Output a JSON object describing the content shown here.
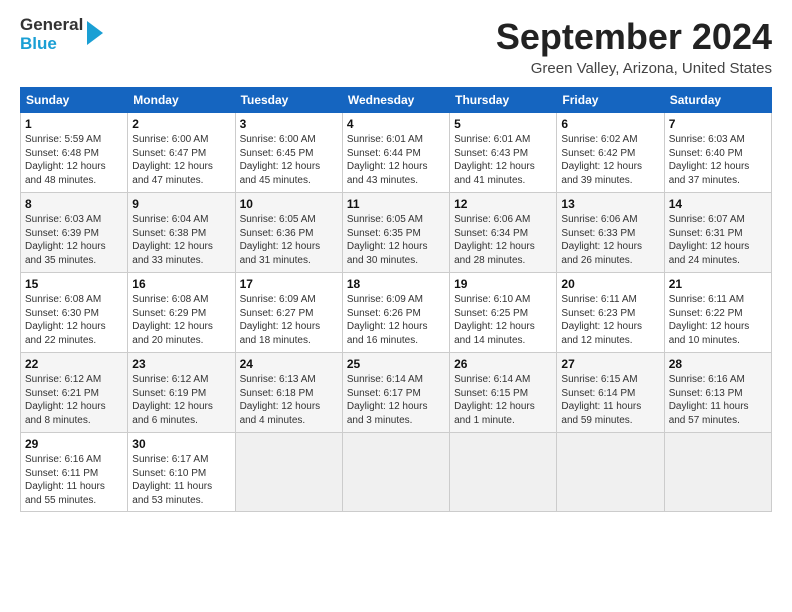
{
  "header": {
    "logo_line1": "General",
    "logo_line2": "Blue",
    "month": "September 2024",
    "location": "Green Valley, Arizona, United States"
  },
  "days_of_week": [
    "Sunday",
    "Monday",
    "Tuesday",
    "Wednesday",
    "Thursday",
    "Friday",
    "Saturday"
  ],
  "weeks": [
    {
      "days": [
        {
          "num": "1",
          "info": "Sunrise: 5:59 AM\nSunset: 6:48 PM\nDaylight: 12 hours\nand 48 minutes."
        },
        {
          "num": "2",
          "info": "Sunrise: 6:00 AM\nSunset: 6:47 PM\nDaylight: 12 hours\nand 47 minutes."
        },
        {
          "num": "3",
          "info": "Sunrise: 6:00 AM\nSunset: 6:45 PM\nDaylight: 12 hours\nand 45 minutes."
        },
        {
          "num": "4",
          "info": "Sunrise: 6:01 AM\nSunset: 6:44 PM\nDaylight: 12 hours\nand 43 minutes."
        },
        {
          "num": "5",
          "info": "Sunrise: 6:01 AM\nSunset: 6:43 PM\nDaylight: 12 hours\nand 41 minutes."
        },
        {
          "num": "6",
          "info": "Sunrise: 6:02 AM\nSunset: 6:42 PM\nDaylight: 12 hours\nand 39 minutes."
        },
        {
          "num": "7",
          "info": "Sunrise: 6:03 AM\nSunset: 6:40 PM\nDaylight: 12 hours\nand 37 minutes."
        }
      ]
    },
    {
      "days": [
        {
          "num": "8",
          "info": "Sunrise: 6:03 AM\nSunset: 6:39 PM\nDaylight: 12 hours\nand 35 minutes."
        },
        {
          "num": "9",
          "info": "Sunrise: 6:04 AM\nSunset: 6:38 PM\nDaylight: 12 hours\nand 33 minutes."
        },
        {
          "num": "10",
          "info": "Sunrise: 6:05 AM\nSunset: 6:36 PM\nDaylight: 12 hours\nand 31 minutes."
        },
        {
          "num": "11",
          "info": "Sunrise: 6:05 AM\nSunset: 6:35 PM\nDaylight: 12 hours\nand 30 minutes."
        },
        {
          "num": "12",
          "info": "Sunrise: 6:06 AM\nSunset: 6:34 PM\nDaylight: 12 hours\nand 28 minutes."
        },
        {
          "num": "13",
          "info": "Sunrise: 6:06 AM\nSunset: 6:33 PM\nDaylight: 12 hours\nand 26 minutes."
        },
        {
          "num": "14",
          "info": "Sunrise: 6:07 AM\nSunset: 6:31 PM\nDaylight: 12 hours\nand 24 minutes."
        }
      ]
    },
    {
      "days": [
        {
          "num": "15",
          "info": "Sunrise: 6:08 AM\nSunset: 6:30 PM\nDaylight: 12 hours\nand 22 minutes."
        },
        {
          "num": "16",
          "info": "Sunrise: 6:08 AM\nSunset: 6:29 PM\nDaylight: 12 hours\nand 20 minutes."
        },
        {
          "num": "17",
          "info": "Sunrise: 6:09 AM\nSunset: 6:27 PM\nDaylight: 12 hours\nand 18 minutes."
        },
        {
          "num": "18",
          "info": "Sunrise: 6:09 AM\nSunset: 6:26 PM\nDaylight: 12 hours\nand 16 minutes."
        },
        {
          "num": "19",
          "info": "Sunrise: 6:10 AM\nSunset: 6:25 PM\nDaylight: 12 hours\nand 14 minutes."
        },
        {
          "num": "20",
          "info": "Sunrise: 6:11 AM\nSunset: 6:23 PM\nDaylight: 12 hours\nand 12 minutes."
        },
        {
          "num": "21",
          "info": "Sunrise: 6:11 AM\nSunset: 6:22 PM\nDaylight: 12 hours\nand 10 minutes."
        }
      ]
    },
    {
      "days": [
        {
          "num": "22",
          "info": "Sunrise: 6:12 AM\nSunset: 6:21 PM\nDaylight: 12 hours\nand 8 minutes."
        },
        {
          "num": "23",
          "info": "Sunrise: 6:12 AM\nSunset: 6:19 PM\nDaylight: 12 hours\nand 6 minutes."
        },
        {
          "num": "24",
          "info": "Sunrise: 6:13 AM\nSunset: 6:18 PM\nDaylight: 12 hours\nand 4 minutes."
        },
        {
          "num": "25",
          "info": "Sunrise: 6:14 AM\nSunset: 6:17 PM\nDaylight: 12 hours\nand 3 minutes."
        },
        {
          "num": "26",
          "info": "Sunrise: 6:14 AM\nSunset: 6:15 PM\nDaylight: 12 hours\nand 1 minute."
        },
        {
          "num": "27",
          "info": "Sunrise: 6:15 AM\nSunset: 6:14 PM\nDaylight: 11 hours\nand 59 minutes."
        },
        {
          "num": "28",
          "info": "Sunrise: 6:16 AM\nSunset: 6:13 PM\nDaylight: 11 hours\nand 57 minutes."
        }
      ]
    },
    {
      "days": [
        {
          "num": "29",
          "info": "Sunrise: 6:16 AM\nSunset: 6:11 PM\nDaylight: 11 hours\nand 55 minutes."
        },
        {
          "num": "30",
          "info": "Sunrise: 6:17 AM\nSunset: 6:10 PM\nDaylight: 11 hours\nand 53 minutes."
        },
        null,
        null,
        null,
        null,
        null
      ]
    }
  ]
}
